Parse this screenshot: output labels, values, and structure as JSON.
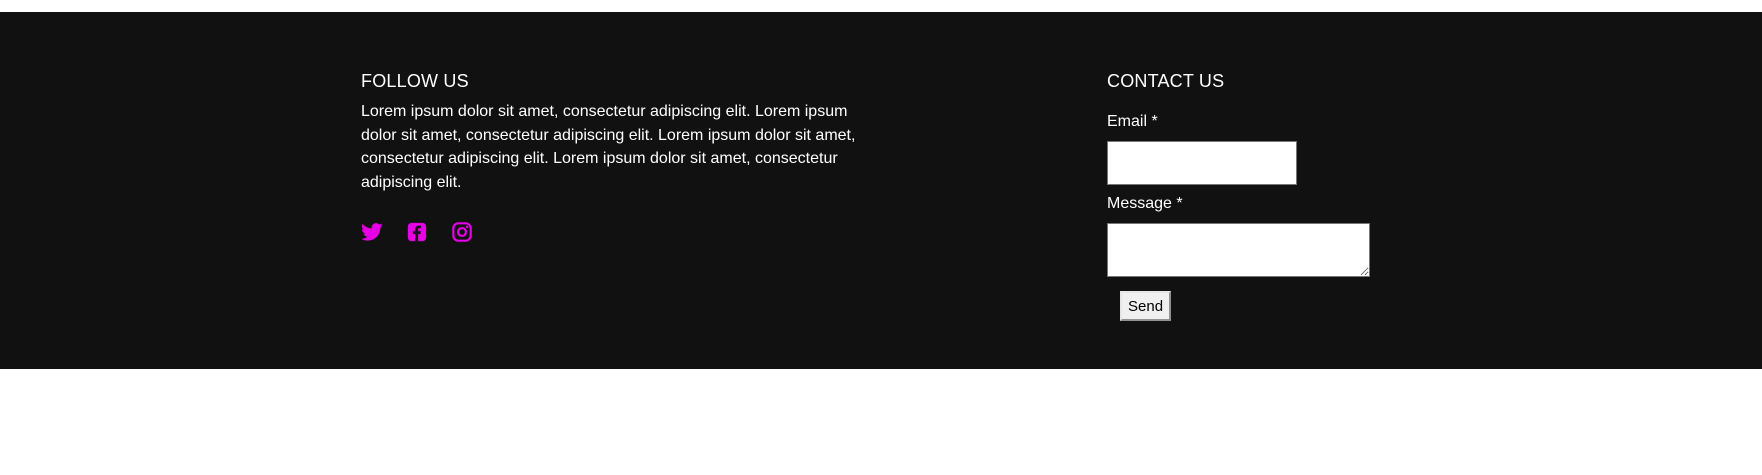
{
  "follow": {
    "title": "FOLLOW US",
    "text": "Lorem ipsum dolor sit amet, consectetur adipiscing elit. Lorem ipsum dolor sit amet, consectetur adipiscing elit. Lorem ipsum dolor sit amet, consectetur adipiscing elit. Lorem ipsum dolor sit amet, consectetur adipiscing elit.",
    "social_icons": [
      "twitter-icon",
      "facebook-icon",
      "instagram-icon"
    ]
  },
  "contact": {
    "title": "CONTACT US",
    "email_label": "Email *",
    "email_value": "",
    "message_label": "Message *",
    "message_value": "",
    "send_label": "Send"
  },
  "colors": {
    "footer_background": "#111111",
    "text": "#ffffff",
    "accent_icons": "#e600e6",
    "page_background": "#ffffff"
  }
}
